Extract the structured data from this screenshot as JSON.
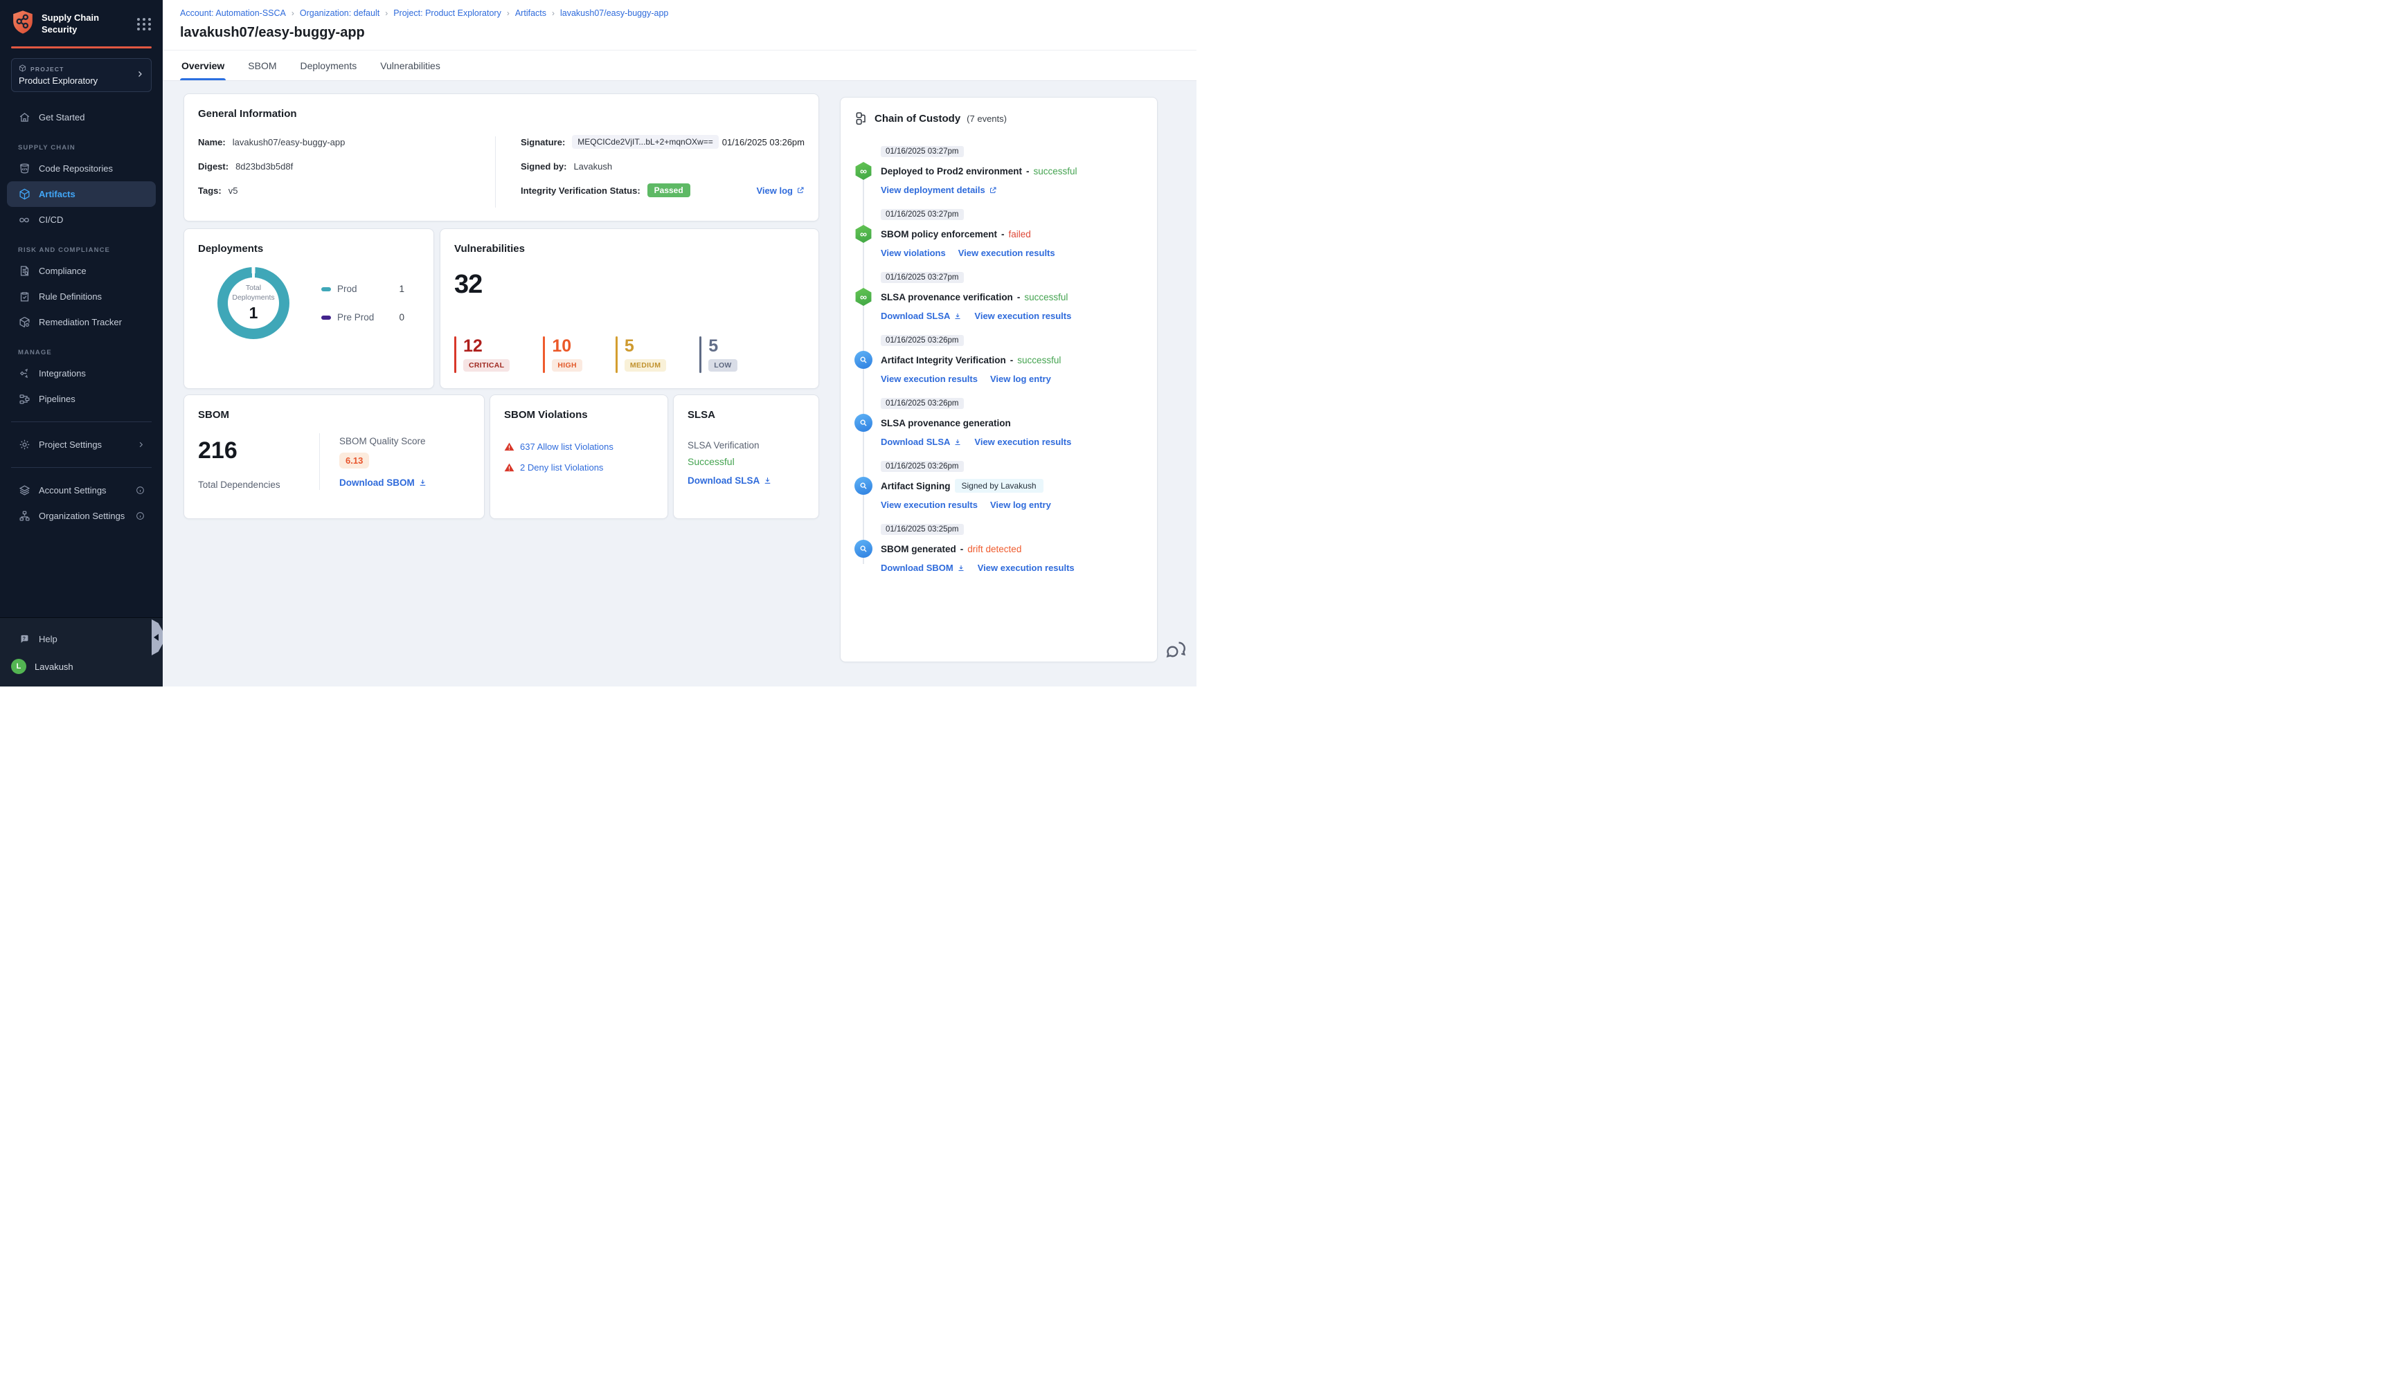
{
  "colors": {
    "accent_blue": "#2F6BDB",
    "sidebar_bg": "#0F1828",
    "active_nav_blue": "#42A7F8",
    "brand_orange": "#E25842",
    "success_green": "#44A350",
    "passed_badge_green": "#5EB965",
    "failed_red": "#DE4837",
    "drift_orange": "#EF5B2E",
    "donut_teal": "#3FA7B8",
    "preprod_purple": "#42238C",
    "critical_red": "#AE1F1C",
    "high_orange": "#EB5828",
    "medium_amber": "#CE9A2F",
    "low_slate": "#626E88"
  },
  "sidebar": {
    "app_title": "Supply Chain Security",
    "project_label": "PROJECT",
    "project_name": "Product Exploratory",
    "sections": [
      "SUPPLY CHAIN",
      "RISK AND COMPLIANCE",
      "MANAGE"
    ],
    "items": [
      {
        "label": "Get Started"
      },
      {
        "label": "Code Repositories"
      },
      {
        "label": "Artifacts"
      },
      {
        "label": "CI/CD"
      },
      {
        "label": "Compliance"
      },
      {
        "label": "Rule Definitions"
      },
      {
        "label": "Remediation Tracker"
      },
      {
        "label": "Integrations"
      },
      {
        "label": "Pipelines"
      },
      {
        "label": "Project Settings"
      },
      {
        "label": "Account Settings"
      },
      {
        "label": "Organization Settings"
      },
      {
        "label": "Help"
      }
    ],
    "user": {
      "name": "Lavakush",
      "initial": "L"
    }
  },
  "breadcrumb": {
    "separator": "›",
    "items": [
      "Account: Automation-SSCA",
      "Organization: default",
      "Project: Product Exploratory",
      "Artifacts",
      "lavakush07/easy-buggy-app"
    ]
  },
  "page": {
    "title": "lavakush07/easy-buggy-app"
  },
  "tabs": [
    {
      "label": "Overview"
    },
    {
      "label": "SBOM"
    },
    {
      "label": "Deployments"
    },
    {
      "label": "Vulnerabilities"
    }
  ],
  "general_info": {
    "title": "General Information",
    "name_label": "Name:",
    "name_value": "lavakush07/easy-buggy-app",
    "digest_label": "Digest:",
    "digest_value": "8d23bd3b5d8f",
    "tags_label": "Tags:",
    "tags_value": "v5",
    "signature_label": "Signature:",
    "signature_value": "MEQCICde2VjIT...bL+2+mqnOXw==",
    "signature_date": "01/16/2025 03:26pm",
    "signed_by_label": "Signed by:",
    "signed_by_value": "Lavakush",
    "integrity_label": "Integrity Verification Status:",
    "integrity_value": "Passed",
    "view_log_label": "View log"
  },
  "deployments": {
    "title": "Deployments",
    "center_label": "Total Deployments",
    "center_value": "1",
    "legend": [
      {
        "label": "Prod",
        "value": "1"
      },
      {
        "label": "Pre Prod",
        "value": "0"
      }
    ]
  },
  "vulnerabilities": {
    "title": "Vulnerabilities",
    "total": "32",
    "severities": [
      {
        "count": "12",
        "label": "CRITICAL"
      },
      {
        "count": "10",
        "label": "HIGH"
      },
      {
        "count": "5",
        "label": "MEDIUM"
      },
      {
        "count": "5",
        "label": "LOW"
      }
    ]
  },
  "sbom": {
    "title": "SBOM",
    "total": "216",
    "total_label": "Total Dependencies",
    "quality_label": "SBOM Quality Score",
    "quality_value": "6.13",
    "download_label": "Download SBOM"
  },
  "sbom_violations": {
    "title": "SBOM Violations",
    "allow_label": "637 Allow list Violations",
    "deny_label": "2 Deny list Violations"
  },
  "slsa": {
    "title": "SLSA",
    "verification_label": "SLSA Verification",
    "status": "Successful",
    "download_label": "Download SLSA"
  },
  "chain": {
    "title": "Chain of Custody",
    "count": "(7 events)",
    "dash": "-",
    "events": [
      {
        "time": "01/16/2025 03:27pm",
        "title": "Deployed to Prod2 environment",
        "status": "successful",
        "links": [
          {
            "label": "View deployment details"
          }
        ]
      },
      {
        "time": "01/16/2025 03:27pm",
        "title": "SBOM policy enforcement",
        "status": "failed",
        "links": [
          {
            "label": "View violations"
          },
          {
            "label": "View execution results"
          }
        ]
      },
      {
        "time": "01/16/2025 03:27pm",
        "title": "SLSA provenance verification",
        "status": "successful",
        "links": [
          {
            "label": "Download SLSA"
          },
          {
            "label": "View execution results"
          }
        ]
      },
      {
        "time": "01/16/2025 03:26pm",
        "title": "Artifact Integrity Verification",
        "status": "successful",
        "links": [
          {
            "label": "View execution results"
          },
          {
            "label": "View log entry"
          }
        ]
      },
      {
        "time": "01/16/2025 03:26pm",
        "title": "SLSA provenance generation",
        "links": [
          {
            "label": "Download SLSA"
          },
          {
            "label": "View execution results"
          }
        ]
      },
      {
        "time": "01/16/2025 03:26pm",
        "title": "Artifact Signing",
        "badge": "Signed by Lavakush",
        "links": [
          {
            "label": "View execution results"
          },
          {
            "label": "View log entry"
          }
        ]
      },
      {
        "time": "01/16/2025 03:25pm",
        "title": "SBOM generated",
        "status": "drift detected",
        "links": [
          {
            "label": "Download SBOM"
          },
          {
            "label": "View execution results"
          }
        ]
      }
    ]
  }
}
